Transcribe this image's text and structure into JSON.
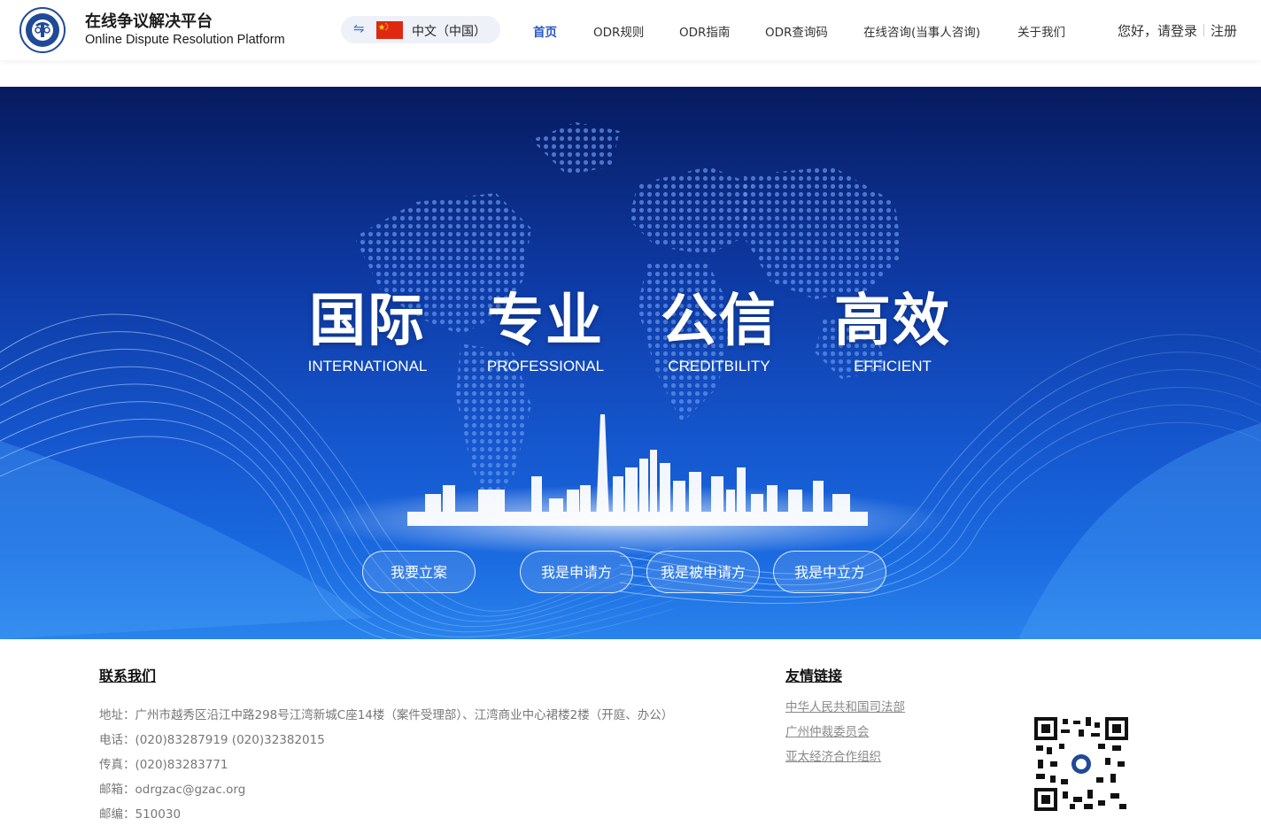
{
  "header": {
    "title": "在线争议解决平台",
    "subtitle": "Online Dispute Resolution Platform",
    "language": {
      "swap_icon": "⇋",
      "label": "中文（中国）"
    },
    "nav": [
      {
        "label": "首页",
        "active": true
      },
      {
        "label": "ODR规则"
      },
      {
        "label": "ODR指南"
      },
      {
        "label": "ODR查询码"
      },
      {
        "label": "在线咨询(当事人咨询)"
      },
      {
        "label": "关于我们"
      }
    ],
    "login": "您好，请登录",
    "register": "注册"
  },
  "banner": {
    "slogans": [
      {
        "cn": "国际",
        "en": "INTERNATIONAL"
      },
      {
        "cn": "专业",
        "en": "PROFESSIONAL"
      },
      {
        "cn": "公信",
        "en": "CREDITBILITY"
      },
      {
        "cn": "高效",
        "en": "EFFICIENT"
      }
    ],
    "buttons": [
      "我要立案",
      "我是申请方",
      "我是被申请方",
      "我是中立方"
    ]
  },
  "footer": {
    "contact_title": "联系我们",
    "contact": [
      "地址：广州市越秀区沿江中路298号江湾新城C座14楼（案件受理部）、江湾商业中心裙楼2楼（开庭、办公）",
      "电话：(020)83287919 (020)32382015",
      "传真：(020)83283771",
      "邮箱：odrgzac@gzac.org",
      "邮编：510030"
    ],
    "links_title": "友情链接",
    "links": [
      "中华人民共和国司法部",
      "广州仲裁委员会",
      "亚太经济合作组织"
    ]
  },
  "colors": {
    "accent": "#2a56c6",
    "banner_dark": "#071a5e",
    "banner_light": "#2a83ec"
  }
}
